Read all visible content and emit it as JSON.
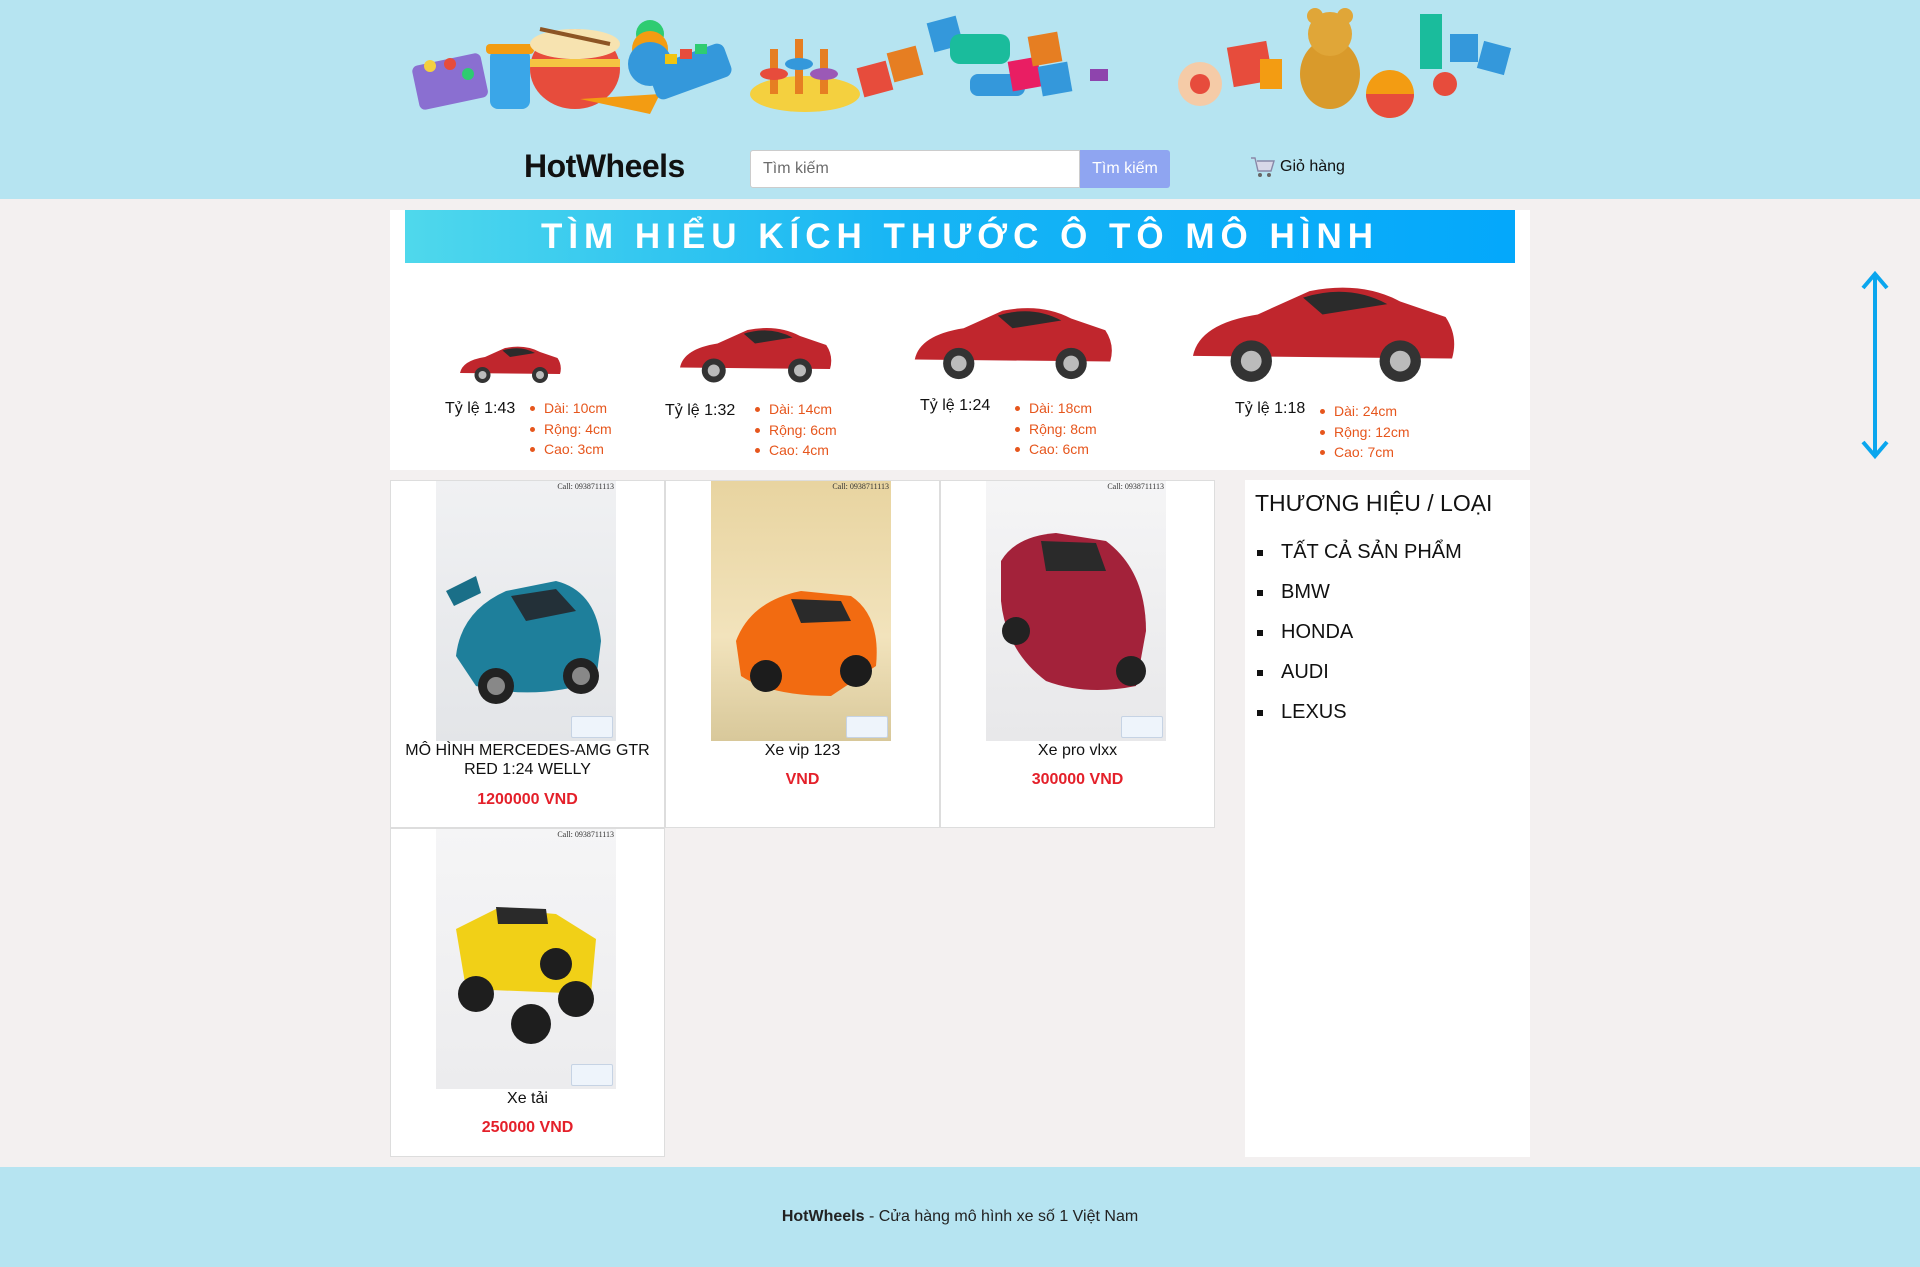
{
  "header": {
    "brand": "HotWheels",
    "search_placeholder": "Tìm kiếm",
    "search_button": "Tìm kiếm",
    "cart_label": "Giỏ hàng"
  },
  "scale_banner": {
    "title": "TÌM HIỂU KÍCH THƯỚC Ô TÔ MÔ HÌNH",
    "scales": [
      {
        "label": "Tỷ lệ 1:43",
        "dims": [
          "Dài: 10cm",
          "Rộng: 4cm",
          "Cao: 3cm"
        ]
      },
      {
        "label": "Tỷ lệ 1:32",
        "dims": [
          "Dài: 14cm",
          "Rộng: 6cm",
          "Cao: 4cm"
        ]
      },
      {
        "label": "Tỷ lệ 1:24",
        "dims": [
          "Dài: 18cm",
          "Rộng: 8cm",
          "Cao: 6cm"
        ]
      },
      {
        "label": "Tỷ lệ 1:18",
        "dims": [
          "Dài: 24cm",
          "Rộng: 12cm",
          "Cao: 7cm"
        ]
      }
    ]
  },
  "products": [
    {
      "name": "MÔ HÌNH MERCEDES-AMG GTR RED 1:24 WELLY",
      "price": "1200000 VND",
      "watermark": "Call: 0938711113"
    },
    {
      "name": "Xe vip 123",
      "price": "VND",
      "watermark": "Call: 0938711113"
    },
    {
      "name": "Xe pro vlxx",
      "price": "300000 VND",
      "watermark": "Call: 0938711113"
    },
    {
      "name": "Xe tải",
      "price": "250000 VND",
      "watermark": "Call: 0938711113"
    }
  ],
  "sidebar": {
    "title": "THƯƠNG HIỆU / LOẠI",
    "items": [
      "TẤT CẢ SẢN PHẨM",
      "BMW",
      "HONDA",
      "AUDI",
      "LEXUS"
    ]
  },
  "footer": {
    "brand": "HotWheels",
    "text": " - Cửa hàng mô hình xe số 1 Việt Nam"
  },
  "colors": {
    "header_bg": "#b6e4f1",
    "page_bg": "#f3f0f0",
    "search_button": "#8fa5f1",
    "price": "#e4202a",
    "dims": "#e6561d",
    "banner_title": "#04a8fb"
  },
  "icons": [
    "cart-icon",
    "arrow-vertical-icon",
    "toy-illustration"
  ]
}
